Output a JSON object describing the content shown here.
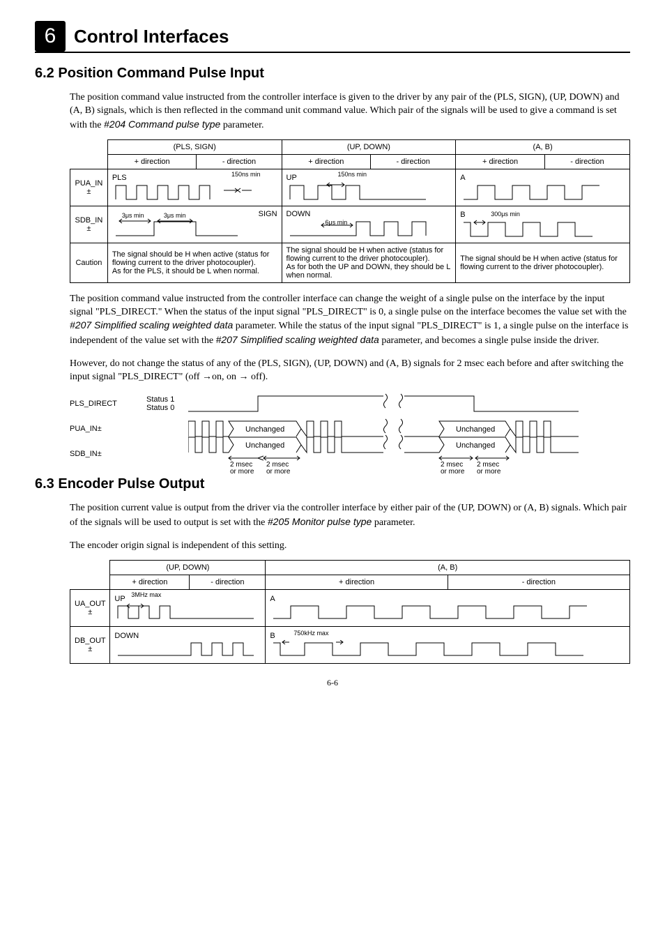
{
  "chapter": {
    "num": "6",
    "title": "Control Interfaces"
  },
  "sec62": {
    "heading": "6.2    Position Command Pulse Input",
    "para1a": "The position command value instructed from the controller interface is given to the driver by any pair of the (PLS, SIGN), (UP, DOWN) and (A, B) signals, which is then reflected in the command unit command value. Which pair of the signals will be used to give a command is set with the ",
    "param1": "#204 Command pulse type",
    "para1b": " parameter.",
    "table": {
      "h1": "(PLS, SIGN)",
      "h2": "(UP, DOWN)",
      "h3": "(A, B)",
      "sub_plus": "+ direction",
      "sub_minus": "- direction",
      "row1": "PUA_IN ±",
      "row2": "SDB_IN ±",
      "row3": "Caution",
      "sig_pls": "PLS",
      "sig_up": "UP",
      "sig_a": "A",
      "sig_sign": "SIGN",
      "sig_down": "DOWN",
      "sig_b": "B",
      "t_150ns": "150ns min",
      "t_3us": "3μs min",
      "t_6us": "6μs min",
      "t_300us": "300μs min",
      "c1": "The signal should be H when active (status for flowing current to the driver photocoupler).\nAs for the PLS, it should be L when normal.",
      "c2": "The signal should be H when active (status for flowing current to the driver photocoupler).\nAs for both the UP and DOWN, they should be L when normal.",
      "c3": "The signal should be H when active (status for flowing current to the driver photocoupler)."
    },
    "para2a": "The position command value instructed from the controller interface can change the weight of a single pulse on the interface by the input signal \"PLS_DIRECT.\" When the status of the input signal \"PLS_DIRECT\" is 0, a single pulse on the interface becomes the value set with the ",
    "param2": "#207 Simplified scaling weighted data",
    "para2b": " parameter. While the status of the input signal \"PLS_DIRECT\" is 1, a single pulse on the interface is independent of the value set with the ",
    "param3": "#207 Simplified scaling weighted data",
    "para2c": " parameter, and becomes a single pulse inside the driver.",
    "para3": "However, do not change the status of any of the (PLS, SIGN), (UP, DOWN) and (A, B) signals for 2 msec each before and after switching the input signal \"PLS_DIRECT\" (off  →on, on  →  off).",
    "timing": {
      "r1": "PLS_DIRECT",
      "s1": "Status 1",
      "s0": "Status 0",
      "r2": "PUA_IN±",
      "r3": "SDB_IN±",
      "unch": "Unchanged",
      "t2m": "2 msec",
      "ormore": "or more"
    }
  },
  "sec63": {
    "heading": "6.3    Encoder Pulse Output",
    "para1a": "The position current value is output from the driver via the controller interface by either pair of the (UP, DOWN) or (A, B) signals. Which pair of the signals will be used to output is set with the ",
    "param1": "#205 Monitor pulse type",
    "para1b": " parameter.",
    "para2": "The encoder origin signal is independent of this setting.",
    "table": {
      "h1": "(UP, DOWN)",
      "h2": "(A, B)",
      "sub_plus": "+ direction",
      "sub_minus": "- direction",
      "row1": "UA_OUT ±",
      "row2": "DB_OUT ±",
      "sig_up": "UP",
      "sig_a": "A",
      "sig_down": "DOWN",
      "sig_b": "B",
      "t_3m": "3MHz max",
      "t_750k": "750kHz max"
    }
  },
  "pagefoot": "6-6"
}
